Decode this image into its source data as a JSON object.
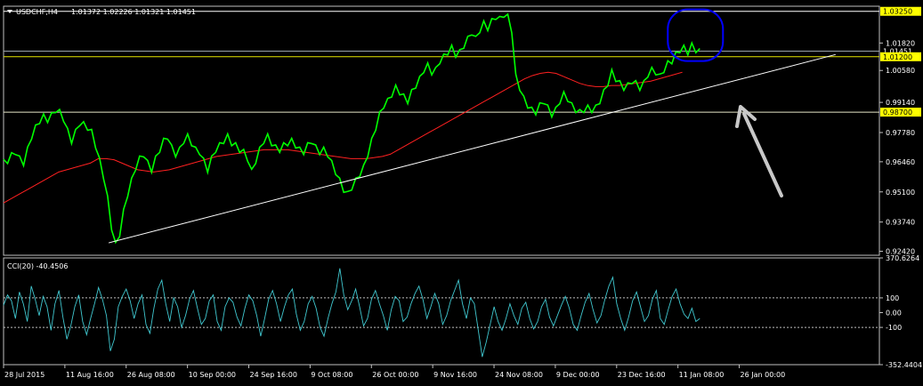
{
  "chart_data": {
    "type": "line",
    "header": {
      "symbol": "USDCHF,H4",
      "ohlc": "1.01372 1.02226 1.01321 1.01451"
    },
    "price_axis": {
      "ylim": [
        0.9224,
        1.0348
      ],
      "ticks": [
        "1.01820",
        "1.00580",
        "0.99140",
        "0.97780",
        "0.96460",
        "0.95100",
        "0.93740",
        "0.92420"
      ],
      "tick_values": [
        1.0182,
        1.0058,
        0.9914,
        0.9778,
        0.9646,
        0.951,
        0.9374,
        0.9242
      ]
    },
    "levels": [
      {
        "label": "1.03250",
        "value": 1.0325,
        "color": "#ffffff"
      },
      {
        "label": "1.01451",
        "value": 1.01451,
        "color": "#9aa3ad"
      },
      {
        "label": "1.01200",
        "value": 1.012,
        "color": "#e6e600"
      },
      {
        "label": "0.98700",
        "value": 0.987,
        "color": "#e6e6c8"
      }
    ],
    "time_axis": {
      "labels": [
        "28 Jul 2015",
        "11 Aug 16:00",
        "26 Aug 08:00",
        "10 Sep 00:00",
        "24 Sep 16:00",
        "9 Oct 08:00",
        "26 Oct 00:00",
        "9 Nov 16:00",
        "24 Nov 08:00",
        "9 Dec 00:00",
        "23 Dec 16:00",
        "11 Jan 08:00",
        "26 Jan 00:00"
      ]
    },
    "price_series": {
      "x": [
        0,
        6,
        12,
        18,
        24,
        30,
        36,
        42,
        48,
        54,
        60,
        66,
        72,
        78,
        84,
        90,
        96,
        102,
        108,
        114,
        120,
        126,
        132,
        138,
        144,
        150,
        156,
        162,
        168,
        174,
        180,
        186,
        192,
        198,
        204,
        210,
        216,
        222,
        228,
        234,
        240,
        246,
        252,
        258,
        264,
        270,
        276,
        282,
        288,
        294,
        300,
        306,
        312,
        318,
        324,
        330,
        336,
        342,
        348,
        354,
        360,
        366,
        372,
        378,
        384,
        390,
        396,
        402,
        408,
        414,
        420,
        426,
        432,
        438,
        444,
        450,
        456,
        462,
        468,
        474,
        480,
        486,
        492,
        498,
        504,
        510,
        516,
        522,
        528,
        534,
        540,
        546,
        552,
        558,
        564,
        570,
        576,
        582,
        588,
        594,
        600,
        606,
        612,
        618,
        624,
        630,
        636,
        642,
        648,
        654,
        660,
        666,
        672,
        678,
        684,
        690,
        696,
        702,
        708,
        714,
        720,
        726,
        732,
        738,
        744,
        750,
        756,
        762,
        768,
        774,
        780,
        786,
        792,
        798,
        804,
        810,
        816,
        822,
        828,
        834,
        840,
        846,
        852,
        858,
        864,
        870,
        876,
        882,
        888,
        894,
        900,
        906,
        912,
        918,
        924,
        930,
        936,
        942,
        948,
        954,
        960,
        966,
        972,
        978,
        984,
        990,
        996,
        1002,
        1008,
        1014,
        1020,
        1026,
        1032,
        1038,
        1044,
        1050,
        1056,
        1062,
        1068,
        1074,
        1080,
        1086,
        1092,
        1098,
        1104,
        1110,
        1116,
        1122,
        1128,
        1134,
        1140,
        1146,
        1152,
        1158,
        1164,
        1170,
        1176,
        1182,
        1188,
        1194,
        1200,
        1206,
        1212,
        1218,
        1224,
        1230,
        1236,
        1242,
        1248,
        1254,
        1260,
        1266,
        1272,
        1278,
        1284,
        1290,
        1296,
        1302,
        1308,
        1314,
        1320,
        1326,
        1332,
        1338,
        1344,
        1350,
        1356,
        1362,
        1368,
        1374,
        1380,
        1386,
        1392,
        1398,
        1404,
        1410,
        1416,
        1422,
        1428,
        1434,
        1440,
        1446,
        1452,
        1458,
        1464,
        1470,
        1476,
        1482,
        1488,
        1494,
        1500,
        1506,
        1512,
        1518,
        1524,
        1530,
        1536,
        1542,
        1548,
        1554,
        1560
      ],
      "values": [
        0.9645,
        0.965,
        0.9675,
        0.969,
        0.966,
        0.964,
        0.97,
        0.976,
        0.98,
        0.983,
        0.985,
        0.9835,
        0.9855,
        0.988,
        0.987,
        0.984,
        0.9785,
        0.974,
        0.978,
        0.982,
        0.9815,
        0.98,
        0.978,
        0.972,
        0.965,
        0.958,
        0.948,
        0.935,
        0.927,
        0.932,
        0.942,
        0.95,
        0.956,
        0.962,
        0.966,
        0.968,
        0.964,
        0.961,
        0.966,
        0.97,
        0.974,
        0.976,
        0.971,
        0.968,
        0.97,
        0.974,
        0.976,
        0.973,
        0.97,
        0.969,
        0.965,
        0.961,
        0.966,
        0.97,
        0.972,
        0.974,
        0.976,
        0.973,
        0.972,
        0.97,
        0.969,
        0.966,
        0.96,
        0.965,
        0.97,
        0.974,
        0.976,
        0.973,
        0.971,
        0.97,
        0.972,
        0.973,
        0.974,
        0.972,
        0.97,
        0.969,
        0.972,
        0.974,
        0.971,
        0.969,
        0.97,
        0.968,
        0.964,
        0.96,
        0.956,
        0.952,
        0.95,
        0.953,
        0.956,
        0.959,
        0.962,
        0.968,
        0.974,
        0.98,
        0.986,
        0.99,
        0.992,
        0.995,
        0.998,
        0.996,
        0.994,
        0.992,
        0.996,
        0.999,
        1.002,
        1.006,
        1.008,
        1.005,
        1.006,
        1.01,
        1.012,
        1.014,
        1.016,
        1.013,
        1.014,
        1.017,
        1.02,
        1.023,
        1.02,
        1.024,
        1.027,
        1.025,
        1.028,
        1.03,
        1.029,
        1.031,
        1.03,
        1.024,
        1.003,
        0.998,
        0.993,
        0.99,
        0.988,
        0.987,
        0.99,
        0.992,
        0.989,
        0.986,
        0.988,
        0.992,
        0.995,
        0.993,
        0.99,
        0.988,
        0.987,
        0.988,
        0.989,
        0.988,
        0.989,
        0.992,
        0.996,
        1.0,
        1.005,
        1.002,
        1.0,
        0.998,
        0.999,
        1.001,
        1.0,
        0.998,
        1.0,
        1.004,
        1.006,
        1.005,
        1.003,
        1.006,
        1.009,
        1.01,
        1.013,
        1.015,
        1.016,
        1.014,
        1.017,
        1.015,
        1.0145
      ],
      "color": "#00ff00"
    },
    "moving_average": {
      "color": "#ff2020",
      "values": [
        0.946,
        0.948,
        0.95,
        0.952,
        0.954,
        0.956,
        0.958,
        0.96,
        0.961,
        0.962,
        0.963,
        0.964,
        0.966,
        0.966,
        0.9655,
        0.964,
        0.9625,
        0.961,
        0.9605,
        0.96,
        0.9605,
        0.961,
        0.962,
        0.963,
        0.964,
        0.965,
        0.966,
        0.967,
        0.9675,
        0.968,
        0.9685,
        0.969,
        0.9695,
        0.97,
        0.97,
        0.97,
        0.97,
        0.9695,
        0.969,
        0.9685,
        0.968,
        0.9675,
        0.967,
        0.9665,
        0.966,
        0.966,
        0.966,
        0.9665,
        0.967,
        0.968,
        0.97,
        0.972,
        0.974,
        0.976,
        0.978,
        0.98,
        0.982,
        0.984,
        0.986,
        0.988,
        0.99,
        0.992,
        0.994,
        0.996,
        0.998,
        1.0,
        1.002,
        1.0035,
        1.0045,
        1.005,
        1.0045,
        1.003,
        1.0015,
        1.0,
        0.999,
        0.9985,
        0.9985,
        0.999,
        0.999,
        0.9995,
        1.0,
        1.0005,
        1.001,
        1.002,
        1.003,
        1.004,
        1.005
      ]
    },
    "trendline": {
      "color": "#ffffff",
      "start": [
        0.12,
        0.928
      ],
      "end": [
        0.95,
        1.013
      ]
    },
    "annotations": {
      "circle_color": "#0000ff",
      "arrow_color": "#c8c8c8"
    },
    "cci": {
      "label": "CCI(20) -40.4506",
      "ylim": [
        -352.4404,
        370.6264
      ],
      "ticks": [
        "370.6264",
        "100",
        "0.00",
        "-100",
        "-352.4404"
      ],
      "tick_values": [
        370.6264,
        100,
        0,
        -100,
        -352.4404
      ],
      "color": "#40c8d0",
      "values": [
        50,
        120,
        80,
        -40,
        140,
        60,
        -60,
        180,
        90,
        -20,
        110,
        40,
        -120,
        60,
        150,
        -30,
        -180,
        -90,
        40,
        120,
        -60,
        -150,
        -40,
        60,
        170,
        90,
        -20,
        -260,
        -180,
        40,
        110,
        160,
        80,
        -40,
        60,
        120,
        -80,
        -140,
        30,
        160,
        220,
        60,
        -60,
        100,
        40,
        -100,
        -20,
        90,
        150,
        30,
        -80,
        -40,
        80,
        120,
        -60,
        -120,
        40,
        100,
        70,
        -30,
        -90,
        30,
        120,
        80,
        -20,
        -160,
        -40,
        90,
        150,
        60,
        -60,
        40,
        120,
        160,
        -10,
        -120,
        -60,
        60,
        110,
        30,
        -100,
        -160,
        -40,
        60,
        140,
        300,
        120,
        20,
        80,
        160,
        40,
        -90,
        -40,
        90,
        150,
        60,
        -20,
        -120,
        20,
        110,
        80,
        -60,
        -30,
        60,
        130,
        180,
        90,
        -40,
        40,
        130,
        60,
        -80,
        -20,
        80,
        150,
        220,
        60,
        -40,
        100,
        60,
        -120,
        -300,
        -200,
        -80,
        40,
        -60,
        -120,
        -40,
        60,
        -20,
        -80,
        30,
        70,
        -40,
        -110,
        -60,
        40,
        90,
        -30,
        -90,
        -20,
        50,
        110,
        30,
        -80,
        -120,
        -20,
        70,
        130,
        20,
        -70,
        -20,
        90,
        180,
        240,
        60,
        -40,
        -120,
        -30,
        80,
        140,
        40,
        -60,
        -20,
        90,
        150,
        -40,
        -80,
        20,
        110,
        160,
        60,
        -10,
        -40,
        30,
        -60,
        -40
      ]
    }
  }
}
